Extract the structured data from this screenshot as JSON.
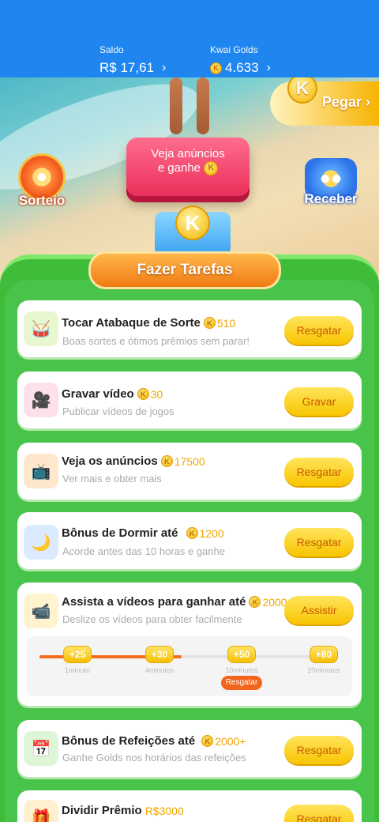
{
  "header": {
    "saldo_label": "Saldo",
    "saldo_value": "R$ 17,61",
    "golds_label": "Kwai Golds",
    "golds_value": "4.633",
    "chevron": "›"
  },
  "hero": {
    "cta_line1": "Veja anúncios",
    "cta_line2": "e ganhe",
    "pegar_label": "Pegar",
    "pegar_chevron": "›",
    "sorteio_label": "Sorteio",
    "receber_label": "Receber"
  },
  "section_title": "Fazer Tarefas",
  "coin_letter": "K",
  "tasks": [
    {
      "title": "Tocar Atabaque de Sorte",
      "reward": "510",
      "subtitle": "Boas sortes e ótimos prêmios sem parar!",
      "button": "Resgatar",
      "icon": "drum-icon"
    },
    {
      "title": "Gravar vídeo",
      "reward": "30",
      "subtitle": "Publicar vídeos de jogos",
      "button": "Gravar",
      "icon": "video-record-icon"
    },
    {
      "title": "Veja os anúncios",
      "reward": "17500",
      "subtitle": "Ver mais e obter mais",
      "button": "Resgatar",
      "icon": "tv-icon"
    },
    {
      "title": "Bônus de Dormir até",
      "reward": "1200",
      "subtitle": "Acorde antes das 10 horas e ganhe",
      "button": "Resgatar",
      "icon": "sleep-icon"
    },
    {
      "title": "Assista a vídeos para ganhar até",
      "reward": "2000",
      "subtitle": "Deslize os vídeos para obter facilmente",
      "button": "Assistir",
      "icon": "camera-icon"
    },
    {
      "title": "Bônus de Refeições até",
      "reward": "2000+",
      "subtitle": "Ganhe Golds nos horários das refeições",
      "button": "Resgatar",
      "icon": "calendar-icon"
    },
    {
      "title": "Dividir Prêmio",
      "reward": "R$3000",
      "subtitle": "",
      "button": "Resgatar",
      "icon": "gift-icon"
    }
  ],
  "watch_progress": {
    "fraction_filled": 0.48,
    "nodes": [
      {
        "reward": "+25",
        "label": "1minuto"
      },
      {
        "reward": "+30",
        "label": "4minutos"
      },
      {
        "reward": "+50",
        "label": "10minutos"
      },
      {
        "reward": "+80",
        "label": "20minutos"
      }
    ],
    "claim_label": "Resgatar"
  },
  "colors": {
    "header_blue": "#1f86f0",
    "board_green": "#3ebc3a",
    "button_yellow": "#f8c500",
    "reward_gold": "#f0a500",
    "progress_orange": "#f36d1c"
  }
}
